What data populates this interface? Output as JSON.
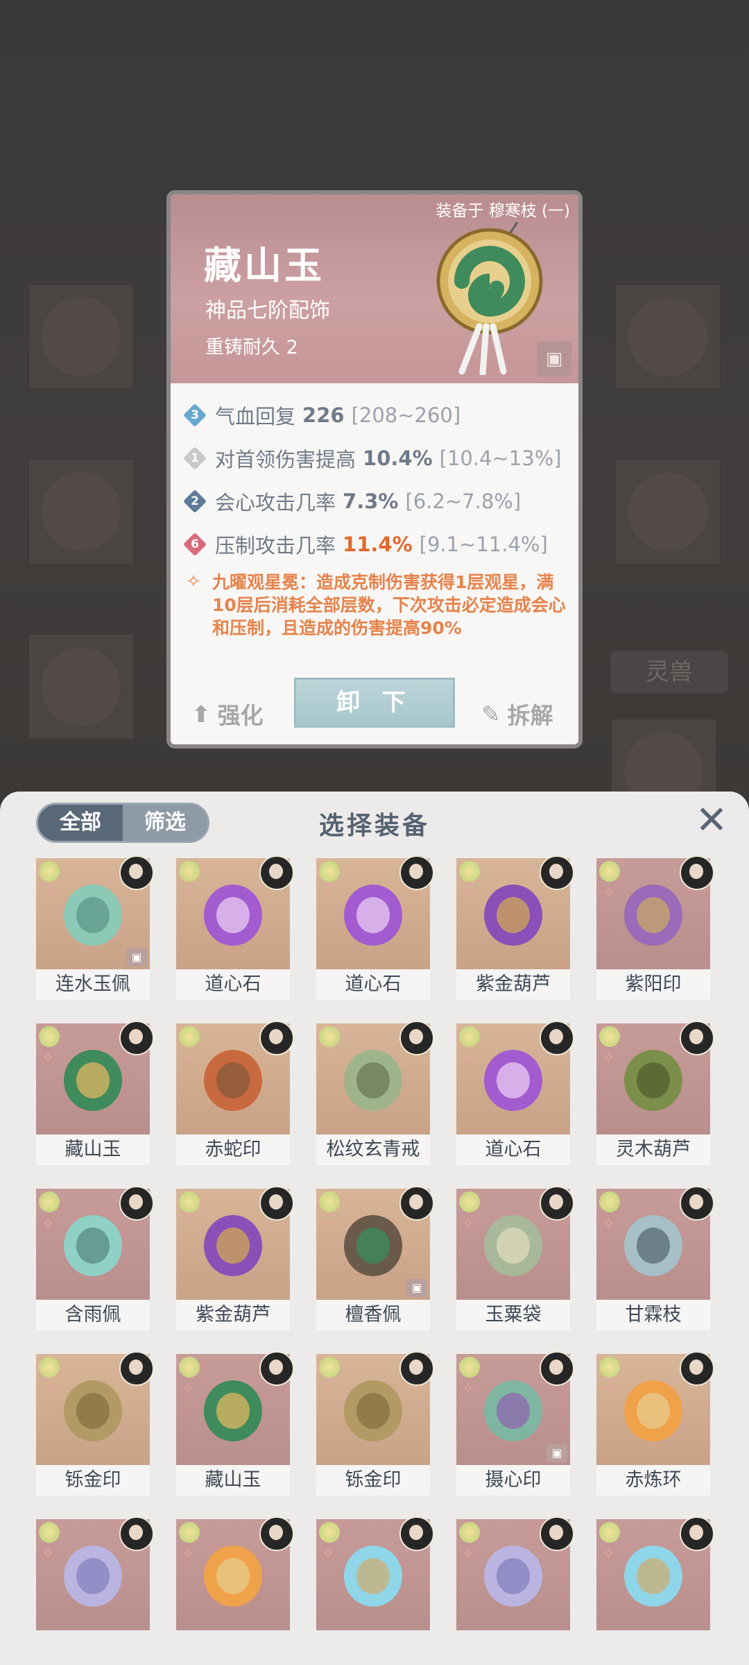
{
  "background": {
    "side_tag_label": "灵兽"
  },
  "detail": {
    "equipped_on": "装备于 穆寒枝 (一)",
    "name": "藏山玉",
    "grade": "神品七阶配饰",
    "recast": "重铸耐久 2",
    "stats": [
      {
        "badge": "3",
        "label": "气血回复",
        "value": "226",
        "range": "[208~260]",
        "color": "#6f7a8a"
      },
      {
        "badge": "1",
        "label": "对首领伤害提高",
        "value": "10.4%",
        "range": "[10.4~13%]",
        "color": "#6f7a8a"
      },
      {
        "badge": "2",
        "label": "会心攻击几率",
        "value": "7.3%",
        "range": "[6.2~7.8%]",
        "color": "#6f7a8a"
      },
      {
        "badge": "6",
        "label": "压制攻击几率",
        "value": "11.4%",
        "range": "[9.1~11.4%]",
        "color": "#e06a2e"
      }
    ],
    "skill": "九曜观星冕：造成克制伤害获得1层观星，满10层后消耗全部层数，下次攻击必定造成会心和压制，且造成的伤害提高90%",
    "buttons": {
      "enhance": "强化",
      "unequip": "卸 下",
      "dismantle": "拆解"
    }
  },
  "picker": {
    "tabs": {
      "all": "全部",
      "filter": "筛选"
    },
    "title": "选择装备",
    "items": [
      {
        "name": "连水玉佩",
        "icon": "jade-pendant-icon"
      },
      {
        "name": "道心石",
        "icon": "purple-orb-icon"
      },
      {
        "name": "道心石",
        "icon": "purple-orb-icon"
      },
      {
        "name": "紫金葫芦",
        "icon": "purple-gourd-icon"
      },
      {
        "name": "紫阳印",
        "icon": "purple-seal-icon"
      },
      {
        "name": "藏山玉",
        "icon": "jade-disc-icon"
      },
      {
        "name": "赤蛇印",
        "icon": "snake-seal-icon"
      },
      {
        "name": "松纹玄青戒",
        "icon": "ring-icon"
      },
      {
        "name": "道心石",
        "icon": "purple-orb-icon"
      },
      {
        "name": "灵木葫芦",
        "icon": "green-gourd-icon"
      },
      {
        "name": "含雨佩",
        "icon": "rain-pendant-icon"
      },
      {
        "name": "紫金葫芦",
        "icon": "purple-gourd-icon"
      },
      {
        "name": "檀香佩",
        "icon": "incense-pendant-icon"
      },
      {
        "name": "玉粟袋",
        "icon": "pouch-icon"
      },
      {
        "name": "甘霖枝",
        "icon": "branch-icon"
      },
      {
        "name": "铄金印",
        "icon": "gold-seal-icon"
      },
      {
        "name": "藏山玉",
        "icon": "jade-disc-icon"
      },
      {
        "name": "铄金印",
        "icon": "gold-seal-icon"
      },
      {
        "name": "摄心印",
        "icon": "jade-seal-icon"
      },
      {
        "name": "赤炼环",
        "icon": "fire-ring-icon"
      },
      {
        "name": "",
        "icon": "spirit-orb-icon"
      },
      {
        "name": "",
        "icon": "fire-ring-icon"
      },
      {
        "name": "",
        "icon": "mirror-icon"
      },
      {
        "name": "",
        "icon": "spirit-orb-icon"
      },
      {
        "name": "",
        "icon": "mirror-icon"
      }
    ]
  }
}
